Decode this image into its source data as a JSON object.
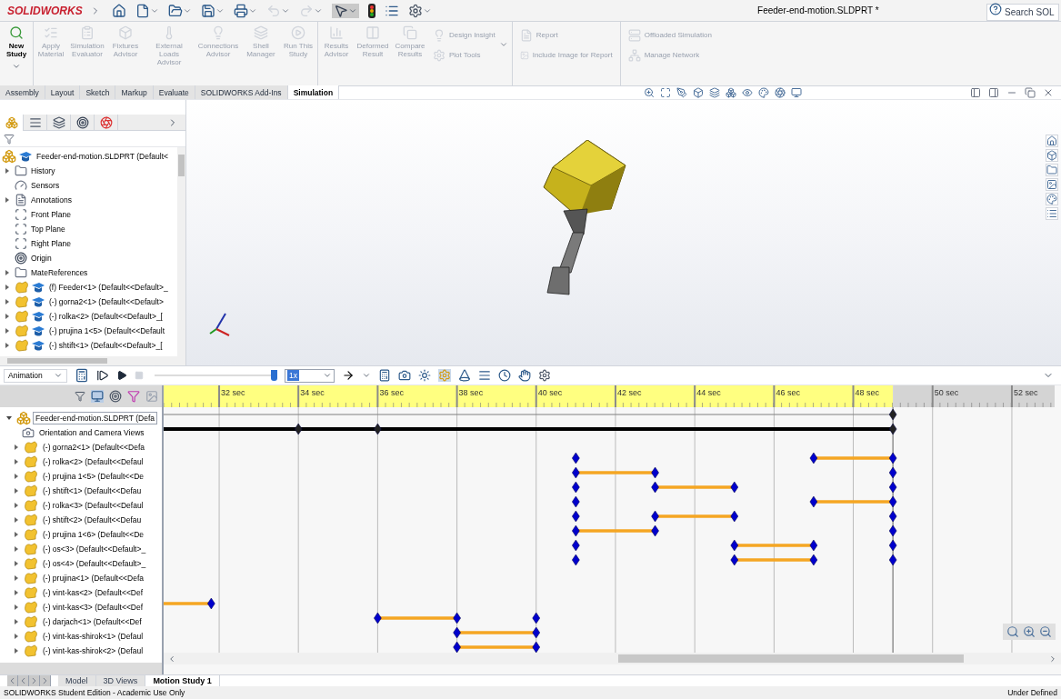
{
  "app": {
    "logo": "SOLIDWORKS",
    "title": "Feeder-end-motion.SLDPRT *",
    "search": {
      "placeholder": "Search SOL"
    }
  },
  "ribbon": {
    "large": [
      {
        "label": "New Study",
        "disabled": false
      },
      {
        "label": "Apply Material",
        "disabled": true
      },
      {
        "label": "Simulation Evaluator",
        "disabled": true
      },
      {
        "label": "Fixtures Advisor",
        "disabled": true
      },
      {
        "label": "External Loads Advisor",
        "disabled": true
      },
      {
        "label": "Connections Advisor",
        "disabled": true
      },
      {
        "label": "Shell Manager",
        "disabled": true
      },
      {
        "label": "Run This Study",
        "disabled": true
      },
      {
        "label": "Results Advisor",
        "disabled": true
      },
      {
        "label": "Deformed Result",
        "disabled": true
      },
      {
        "label": "Compare Results",
        "disabled": true
      }
    ],
    "small": [
      {
        "label": "Design Insight",
        "disabled": true
      },
      {
        "label": "Plot Tools",
        "disabled": true
      },
      {
        "label": "Report",
        "disabled": true
      },
      {
        "label": "Include Image for Report",
        "disabled": true
      },
      {
        "label": "Offloaded Simulation",
        "disabled": true
      },
      {
        "label": "Manage Network",
        "disabled": true
      }
    ]
  },
  "tabs": [
    {
      "label": "Assembly",
      "selected": false
    },
    {
      "label": "Layout",
      "selected": false
    },
    {
      "label": "Sketch",
      "selected": false
    },
    {
      "label": "Markup",
      "selected": false
    },
    {
      "label": "Evaluate",
      "selected": false
    },
    {
      "label": "SOLIDWORKS Add-Ins",
      "selected": false
    },
    {
      "label": "Simulation",
      "selected": true
    }
  ],
  "feature_tree": {
    "tabs": [
      {
        "selected": true
      },
      {
        "selected": false
      },
      {
        "selected": false
      },
      {
        "selected": false
      },
      {
        "selected": false
      }
    ],
    "items": [
      {
        "kind": "root",
        "label": "Feeder-end-motion.SLDPRT  (Default<"
      },
      {
        "kind": "folder",
        "label": "History",
        "expanded": false
      },
      {
        "kind": "sensor",
        "label": "Sensors"
      },
      {
        "kind": "annotation",
        "label": "Annotations",
        "expanded": false
      },
      {
        "kind": "plane",
        "label": "Front Plane"
      },
      {
        "kind": "plane",
        "label": "Top Plane"
      },
      {
        "kind": "plane",
        "label": "Right Plane"
      },
      {
        "kind": "origin",
        "label": "Origin"
      },
      {
        "kind": "folder",
        "label": "MateReferences",
        "expanded": false
      },
      {
        "kind": "component",
        "label": "(f) Feeder<1> (Default<<Default>_",
        "expanded": false
      },
      {
        "kind": "component",
        "label": "(-) gorna2<1> (Default<<Default>",
        "expanded": false
      },
      {
        "kind": "component",
        "label": "(-) rolka<2> (Default<<Default>_[",
        "expanded": false
      },
      {
        "kind": "component",
        "label": "(-) prujina 1<5> (Default<<Default",
        "expanded": false
      },
      {
        "kind": "component",
        "label": "(-) shtift<1> (Default<<Default>_[",
        "expanded": false
      }
    ]
  },
  "motion": {
    "study_type": "Animation",
    "playback": {
      "level": 0.98
    },
    "speed": "1x",
    "timeline": {
      "ruler": [
        {
          "label": "32 sec",
          "level": 0.0623
        },
        {
          "label": "34 sec",
          "level": 0.1512
        },
        {
          "label": "36 sec",
          "level": 0.2402
        },
        {
          "label": "38 sec",
          "level": 0.3292
        },
        {
          "label": "40 sec",
          "level": 0.4181
        },
        {
          "label": "42 sec",
          "level": 0.5071
        },
        {
          "label": "44 sec",
          "level": 0.5961
        },
        {
          "label": "46 sec",
          "level": 0.6851
        },
        {
          "label": "48 sec",
          "level": 0.774
        },
        {
          "label": "50 sec",
          "level": 0.863
        },
        {
          "label": "52 sec",
          "level": 0.952
        }
      ],
      "end": {
        "level": 0.8185
      }
    },
    "tree": [
      {
        "kind": "file",
        "label": "Feeder-end-motion.SLDPRT (Defa",
        "expanded": true,
        "selected": true,
        "keyframes": [
          {
            "level": 0.8185,
            "change": false
          }
        ]
      },
      {
        "kind": "camera",
        "label": "Orientation and Camera Views",
        "selected": false,
        "keyframes": [
          {
            "level": 0.1512,
            "change": false
          },
          {
            "level": 0.2402,
            "change": false
          },
          {
            "level": 0.8185,
            "change": false
          }
        ]
      },
      {
        "kind": "component",
        "label": "(-) gorna2<1> (Default<<Defa",
        "expanded": false,
        "selected": false
      },
      {
        "kind": "component",
        "label": "(-) rolka<2> (Default<<Defaul",
        "expanded": false,
        "selected": false,
        "keyframes": [
          {
            "level": 0.4626,
            "change": false
          },
          {
            "level": 0.7295,
            "change": false
          },
          {
            "level": 0.8185,
            "change": true
          }
        ]
      },
      {
        "kind": "component",
        "label": "(-) prujina 1<5> (Default<<De",
        "expanded": false,
        "selected": false,
        "keyframes": [
          {
            "level": 0.4626,
            "change": false
          },
          {
            "level": 0.5516,
            "change": true
          },
          {
            "level": 0.8185,
            "change": false
          }
        ]
      },
      {
        "kind": "component",
        "label": "(-) shtift<1> (Default<<Defau",
        "expanded": false,
        "selected": false,
        "keyframes": [
          {
            "level": 0.4626,
            "change": false
          },
          {
            "level": 0.5516,
            "change": false
          },
          {
            "level": 0.6406,
            "change": true
          },
          {
            "level": 0.8185,
            "change": false
          }
        ]
      },
      {
        "kind": "component",
        "label": "(-) rolka<3> (Default<<Defaul",
        "expanded": false,
        "selected": false,
        "keyframes": [
          {
            "level": 0.4626,
            "change": false
          },
          {
            "level": 0.7295,
            "change": false
          },
          {
            "level": 0.8185,
            "change": true
          }
        ]
      },
      {
        "kind": "component",
        "label": "(-) shtift<2> (Default<<Defau",
        "expanded": false,
        "selected": false,
        "keyframes": [
          {
            "level": 0.4626,
            "change": false
          },
          {
            "level": 0.5516,
            "change": false
          },
          {
            "level": 0.6406,
            "change": true
          },
          {
            "level": 0.8185,
            "change": false
          }
        ]
      },
      {
        "kind": "component",
        "label": "(-) prujina 1<6> (Default<<De",
        "expanded": false,
        "selected": false,
        "keyframes": [
          {
            "level": 0.4626,
            "change": false
          },
          {
            "level": 0.5516,
            "change": true
          },
          {
            "level": 0.8185,
            "change": false
          }
        ]
      },
      {
        "kind": "component",
        "label": "(-) os<3> (Default<<Default>_",
        "expanded": false,
        "selected": false,
        "keyframes": [
          {
            "level": 0.4626,
            "change": false
          },
          {
            "level": 0.6406,
            "change": false
          },
          {
            "level": 0.7295,
            "change": true
          },
          {
            "level": 0.8185,
            "change": false
          }
        ]
      },
      {
        "kind": "component",
        "label": "(-) os<4> (Default<<Default>_",
        "expanded": false,
        "selected": false,
        "keyframes": [
          {
            "level": 0.4626,
            "change": false
          },
          {
            "level": 0.6406,
            "change": false
          },
          {
            "level": 0.7295,
            "change": true
          },
          {
            "level": 0.8185,
            "change": false
          }
        ]
      },
      {
        "kind": "component",
        "label": "(-) prujina<1> (Default<<Defa",
        "expanded": false,
        "selected": false
      },
      {
        "kind": "component",
        "label": "(-) vint-kas<2> (Default<<Def",
        "expanded": false,
        "selected": false
      },
      {
        "kind": "component",
        "label": "(-) vint-kas<3> (Default<<Def",
        "expanded": false,
        "selected": false,
        "keyframes": [
          {
            "level": 0.0534,
            "change": true
          }
        ]
      },
      {
        "kind": "component",
        "label": "(-) darjach<1> (Default<<Def",
        "expanded": false,
        "selected": false,
        "keyframes": [
          {
            "level": 0.2402,
            "change": false
          },
          {
            "level": 0.3292,
            "change": true
          },
          {
            "level": 0.4181,
            "change": false
          }
        ]
      },
      {
        "kind": "component",
        "label": "(-) vint-kas-shirok<1> (Defaul",
        "expanded": false,
        "selected": false,
        "keyframes": [
          {
            "level": 0.3292,
            "change": false
          },
          {
            "level": 0.4181,
            "change": true
          }
        ]
      },
      {
        "kind": "component",
        "label": "(-) vint-kas-shirok<2> (Defaul",
        "expanded": false,
        "selected": false,
        "keyframes": [
          {
            "level": 0.3292,
            "change": false
          },
          {
            "level": 0.4181,
            "change": true
          }
        ]
      }
    ]
  },
  "bottom_tabs": [
    {
      "label": "Model",
      "selected": false
    },
    {
      "label": "3D Views",
      "selected": false
    },
    {
      "label": "Motion Study 1",
      "selected": true
    }
  ],
  "status_bar": {
    "left": "SOLIDWORKS Student Edition - Academic Use Only",
    "right": "Under Defined"
  }
}
